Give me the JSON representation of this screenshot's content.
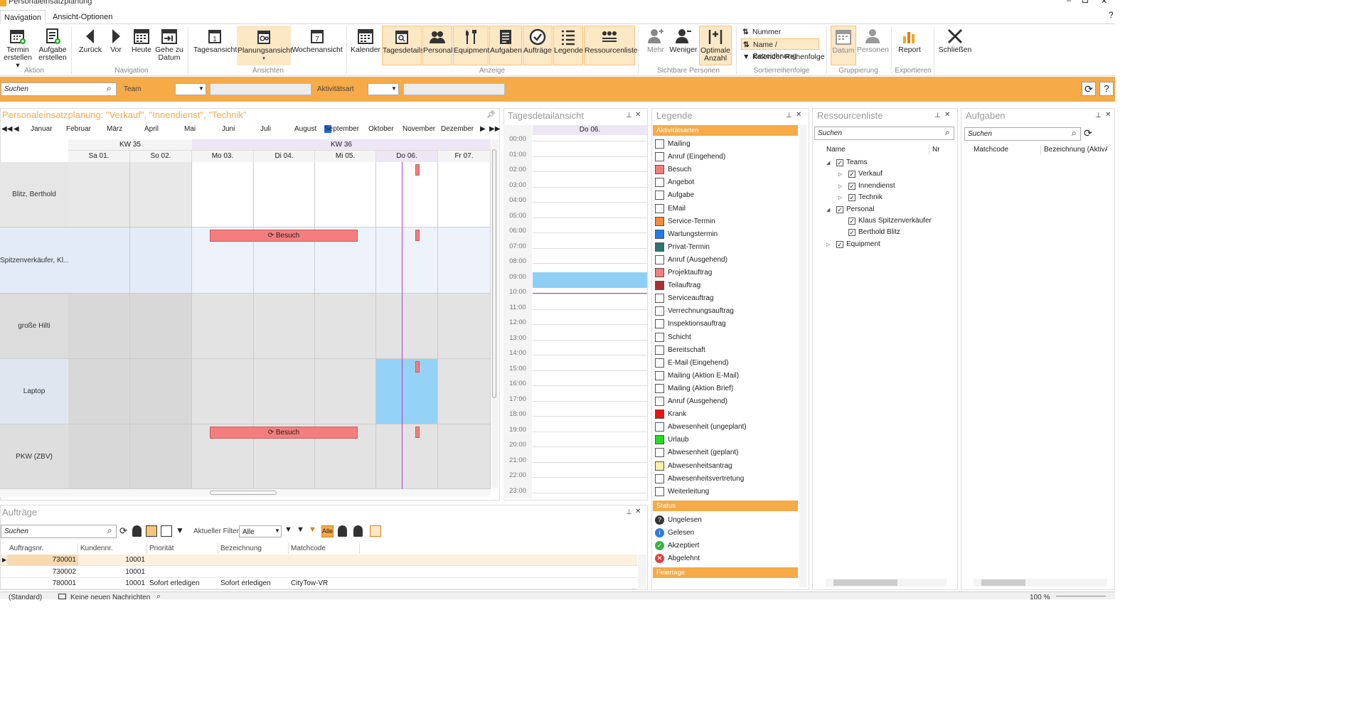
{
  "window": {
    "title": "Personaleinsatzplanung"
  },
  "tabs": [
    "Navigation",
    "Ansicht-Optionen"
  ],
  "ribbon": {
    "buttons": {
      "termin": "Termin\nerstellen ▾",
      "aufgabe": "Aufgabe\nerstellen",
      "zurueck": "Zurück",
      "vor": "Vor",
      "heute": "Heute",
      "gehe": "Gehe zu\nDatum",
      "tages": "Tagesansicht",
      "planung": "Planungsansicht",
      "wochen": "Wochenansicht",
      "kalender": "Kalender",
      "tagesdetails": "Tagesdetails",
      "personal": "Personal",
      "equipment": "Equipment",
      "aufgaben": "Aufgaben",
      "auftraege": "Aufträge",
      "legende": "Legende",
      "ressourcen": "Ressourcenliste",
      "mehr": "Mehr",
      "weniger": "Weniger",
      "optimale": "Optimale\nAnzahl",
      "datum": "Datum",
      "personen": "Personen",
      "report": "Report",
      "schliessen": "Schließen"
    },
    "sort": [
      "Nummer",
      "Name / Bezeichnung",
      "Kalender-Reihenfolge"
    ],
    "groups": [
      "Aktion",
      "Navigation",
      "Ansichten",
      "Anzeige",
      "Sichtbare Personen",
      "Sortierreihenfolge",
      "Gruppierung",
      "Exportieren"
    ]
  },
  "filterbar": {
    "search_placeholder": "Suchen",
    "team_label": "Team",
    "activity_label": "Aktivitätsart"
  },
  "planning": {
    "title": "Personaleinsatzplanung: \"Verkauf\", \"Innendienst\", \"Technik\"",
    "months": [
      "Januar",
      "Februar",
      "März",
      "April",
      "Mai",
      "Juni",
      "Juli",
      "August",
      "September",
      "Oktober",
      "November",
      "Dezember"
    ],
    "selected_month": "September",
    "weeks": [
      "KW 35",
      "KW 36"
    ],
    "days": [
      "Sa 01.",
      "So 02.",
      "Mo 03.",
      "Di 04.",
      "Mi 05.",
      "Do 06.",
      "Fr 07."
    ],
    "rows": [
      "Blitz, Berthold",
      "Spitzenverkäufer, Kl...",
      "große Hilti",
      "Laptop",
      "PKW (ZBV)"
    ],
    "event_label": "Besuch"
  },
  "daydetail": {
    "title": "Tagesdetailansicht",
    "day": "Do 06.",
    "hours": [
      "00:00",
      "01:00",
      "02:00",
      "03:00",
      "04:00",
      "05:00",
      "06:00",
      "07:00",
      "08:00",
      "09:00",
      "10:00",
      "11:00",
      "12:00",
      "13:00",
      "14:00",
      "15:00",
      "16:00",
      "17:00",
      "18:00",
      "19:00",
      "20:00",
      "21:00",
      "22:00",
      "23:00"
    ]
  },
  "legend": {
    "title": "Legende",
    "sections": [
      "Aktivitätsarten",
      "Status",
      "Feiertage"
    ],
    "items": [
      {
        "label": "Mailing",
        "color": "#ffffff"
      },
      {
        "label": "Anruf (Eingehend)",
        "color": "#ffffff"
      },
      {
        "label": "Besuch",
        "color": "#f47e7e"
      },
      {
        "label": "Angebot",
        "color": "#ffffff"
      },
      {
        "label": "Aufgabe",
        "color": "#ffffff"
      },
      {
        "label": "EMail",
        "color": "#ffffff"
      },
      {
        "label": "Service-Termin",
        "color": "#f58a3a"
      },
      {
        "label": "Wartungstermin",
        "color": "#1e7bf0"
      },
      {
        "label": "Privat-Termin",
        "color": "#2e7470"
      },
      {
        "label": "Anruf (Ausgehend)",
        "color": "#ffffff"
      },
      {
        "label": "Projektauftrag",
        "color": "#f47e7e"
      },
      {
        "label": "Teilauftrag",
        "color": "#a83232"
      },
      {
        "label": "Serviceauftrag",
        "color": "#ffffff"
      },
      {
        "label": "Verrechnungsauftrag",
        "color": "#ffffff"
      },
      {
        "label": "Inspektionsauftrag",
        "color": "#ffffff"
      },
      {
        "label": "Schicht",
        "color": "#ffffff"
      },
      {
        "label": "Bereitschaft",
        "color": "#ffffff"
      },
      {
        "label": "E-Mail (Eingehend)",
        "color": "#ffffff"
      },
      {
        "label": "Mailing (Aktion E-Mail)",
        "color": "#ffffff"
      },
      {
        "label": "Mailing (Aktion Brief)",
        "color": "#ffffff"
      },
      {
        "label": "Anruf (Ausgehend)",
        "color": "#ffffff"
      },
      {
        "label": "Krank",
        "color": "#ee1111"
      },
      {
        "label": "Abwesenheit (ungeplant)",
        "color": "#ffffff"
      },
      {
        "label": "Urlaub",
        "color": "#22dd22"
      },
      {
        "label": "Abwesenheit (geplant)",
        "color": "#ffffff"
      },
      {
        "label": "Abwesenheitsantrag",
        "color": "#fbf0a8"
      },
      {
        "label": "Abwesenheitsvertretung",
        "color": "#ffffff"
      },
      {
        "label": "Weiterleitung",
        "color": "#ffffff"
      }
    ],
    "status": [
      {
        "label": "Ungelesen",
        "icon": "question-icon"
      },
      {
        "label": "Gelesen",
        "icon": "info-icon"
      },
      {
        "label": "Akzeptiert",
        "icon": "check-icon"
      },
      {
        "label": "Abgelehnt",
        "icon": "x-icon"
      }
    ]
  },
  "resources": {
    "title": "Ressourcenliste",
    "search_placeholder": "Suchen",
    "col_name": "Name",
    "col_nr": "Nr",
    "tree": [
      "Teams",
      "Verkauf",
      "Innendienst",
      "Technik",
      "Personal",
      "Klaus Spitzenverkäufer",
      "Berthold Blitz",
      "Equipment"
    ]
  },
  "tasks": {
    "title": "Aufgaben",
    "search_placeholder": "Suchen",
    "cols": [
      "Matchcode",
      "Bezeichnung (AktivA..."
    ]
  },
  "orders": {
    "title": "Aufträge",
    "search_placeholder": "Suchen",
    "filter_label": "Aktueller Filter:",
    "filter_value": "Alle",
    "alle_btn": "Alle",
    "cols": [
      "Auftragsnr.",
      "Kundennr.",
      "Priorität",
      "Bezeichnung (PrioBez)",
      "Matchcode"
    ],
    "rows": [
      [
        "730001",
        "10001",
        "",
        "",
        ""
      ],
      [
        "730002",
        "10001",
        "",
        "",
        ""
      ],
      [
        "780001",
        "10001",
        "Sofort erledigen",
        "Sofort erledigen",
        "CityTow-VR"
      ]
    ]
  },
  "statusbar": {
    "left": "(Standard)",
    "msg": "Keine neuen Nachrichten",
    "zoom": "100 %"
  }
}
